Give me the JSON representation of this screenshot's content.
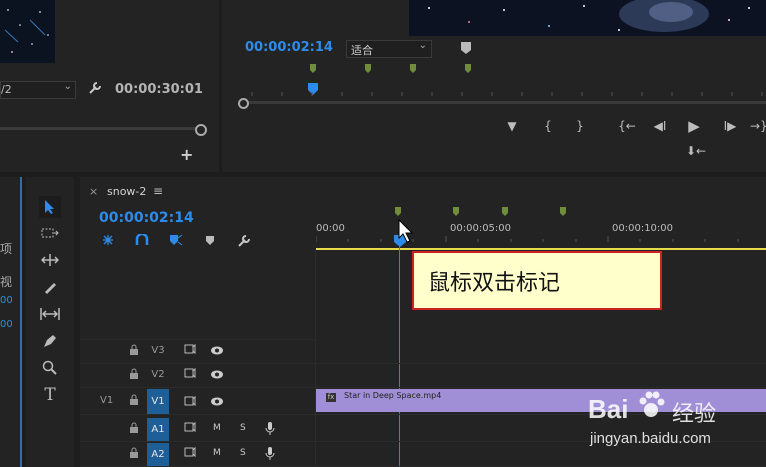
{
  "source_monitor": {
    "scale_value": "/2",
    "duration": "00:00:30:01",
    "add_label": "+"
  },
  "program_monitor": {
    "timecode": "00:00:02:14",
    "fit_value": "适合",
    "transport": {
      "marker": "▼",
      "in": "{",
      "out": "}",
      "go_in": "{←",
      "step_back": "◀I",
      "play": "▶",
      "step_fwd": "I▶",
      "go_out": "→}",
      "overwrite": "⬇←"
    }
  },
  "left_panel": {
    "partial_label_1": "项",
    "partial_label_2": "视",
    "partial_value_1": "00",
    "partial_value_2": "00"
  },
  "timeline": {
    "close_label": "×",
    "sequence_name": "snow-2",
    "menu_label": "≡",
    "timecode": "00:00:02:14",
    "ruler": [
      "00:00",
      "00:00:05:00",
      "00:00:10:00"
    ],
    "tracks": [
      {
        "source": "",
        "name": "V3",
        "active": false,
        "kind": "video"
      },
      {
        "source": "",
        "name": "V2",
        "active": false,
        "kind": "video"
      },
      {
        "source": "V1",
        "name": "V1",
        "active": true,
        "kind": "video"
      },
      {
        "source": "",
        "name": "A1",
        "active": true,
        "kind": "audio"
      },
      {
        "source": "",
        "name": "A2",
        "active": true,
        "kind": "audio"
      }
    ],
    "track_labels": {
      "mute": "M",
      "solo": "S"
    },
    "clip_name": "Star in Deep Space.mp4",
    "clip_fx": "fx"
  },
  "annotation": {
    "text": "鼠标双击标记"
  },
  "watermark": {
    "brand": "Bai",
    "brand_cn": "经验",
    "url": "jingyan.baidu.com"
  },
  "colors": {
    "timecode_blue": "#2d8ceb",
    "marker_green": "#6f8d3a",
    "playhead_blue": "#2d8ceb",
    "clip_purple": "#a08fd6",
    "annotation_bg": "#ffffcc",
    "annotation_border": "#cc2222",
    "workarea_yellow": "#e6d94a"
  }
}
